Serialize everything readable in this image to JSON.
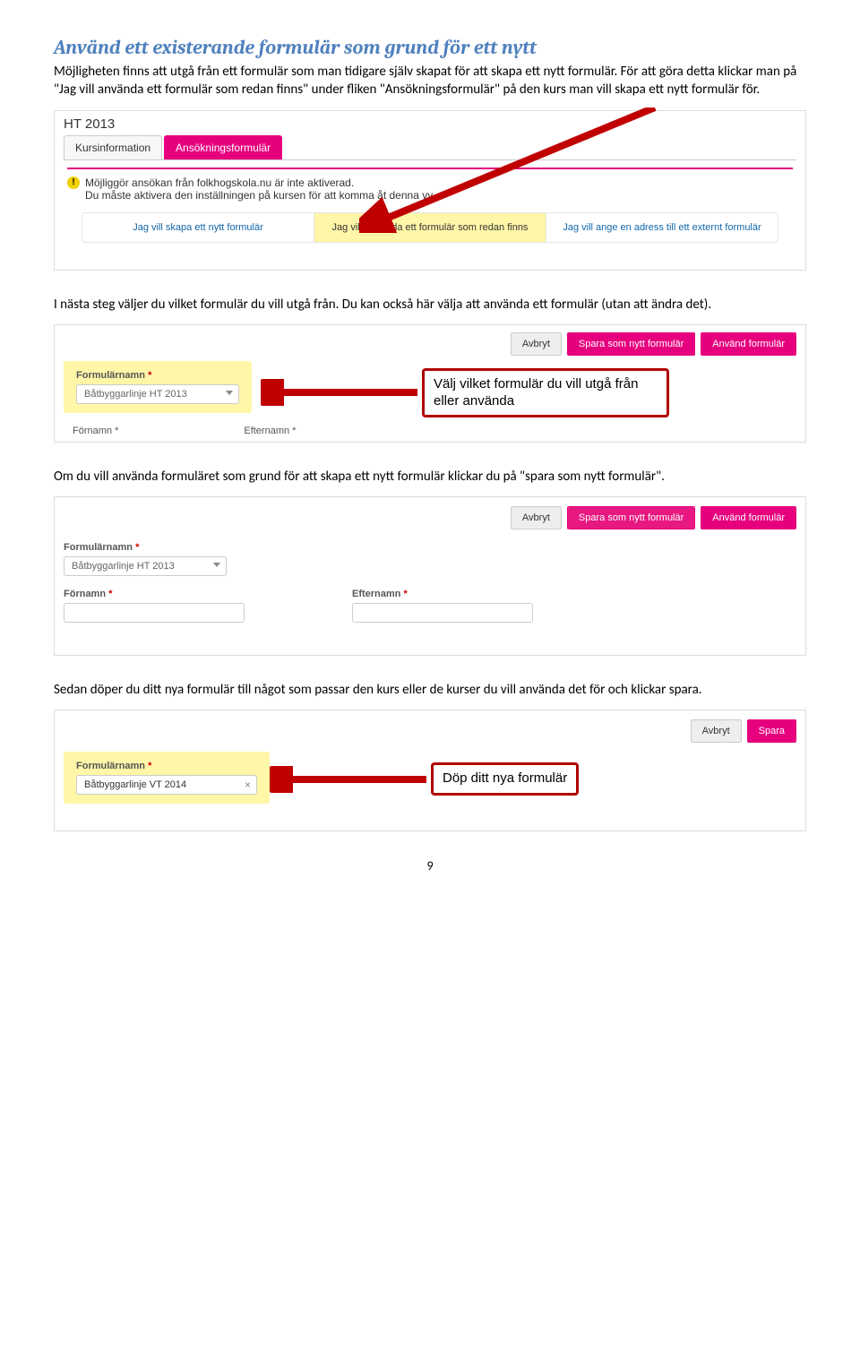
{
  "heading": "Använd ett existerande formulär som grund för ett nytt",
  "p1": "Möjligheten finns att utgå från ett formulär som man tidigare själv skapat för att skapa ett nytt formulär. För att göra detta klickar man på \"Jag vill använda ett formulär som redan finns\" under fliken \"Ansökningsformulär\" på den kurs man vill skapa ett nytt formulär för.",
  "shot1": {
    "term": "HT 2013",
    "tab1": "Kursinformation",
    "tab2": "Ansökningsformulär",
    "alert1": "Möjliggör ansökan från folkhogskola.nu är inte aktiverad.",
    "alert2": "Du måste aktivera den inställningen på kursen för att komma åt denna vy.",
    "opt1": "Jag vill skapa ett nytt formulär",
    "opt2": "Jag vill använda ett formulär som redan finns",
    "opt3": "Jag vill ange en adress till ett externt formulär"
  },
  "p2": "I nästa steg väljer du vilket formulär du vill utgå från. Du kan också här välja att använda ett formulär (utan att ändra det).",
  "shot2": {
    "btn_cancel": "Avbryt",
    "btn_save_new": "Spara som nytt formulär",
    "btn_use": "Använd formulär",
    "label_name": "Formulärnamn",
    "val_name": "Båtbyggarlinje HT 2013",
    "callout": "Välj vilket formulär du vill utgå från eller använda",
    "bf1": "Förnamn *",
    "bf2": "Efternamn *"
  },
  "p3": "Om du vill använda formuläret som grund för att skapa ett nytt formulär klickar du på \"spara som nytt formulär\".",
  "shot3": {
    "btn_cancel": "Avbryt",
    "btn_save_new": "Spara som nytt formulär",
    "btn_use": "Använd formulär",
    "label_name": "Formulärnamn",
    "val_name": "Båtbyggarlinje HT 2013",
    "lab_fn": "Förnamn",
    "lab_en": "Efternamn"
  },
  "p4": "Sedan döper du ditt nya formulär till något som passar den kurs eller de kurser du vill använda det för och klickar spara.",
  "shot4": {
    "btn_cancel": "Avbryt",
    "btn_save": "Spara",
    "label_name": "Formulärnamn",
    "val_name": "Båtbyggarlinje VT 2014",
    "callout": "Döp ditt nya formulär"
  },
  "page_number": "9"
}
